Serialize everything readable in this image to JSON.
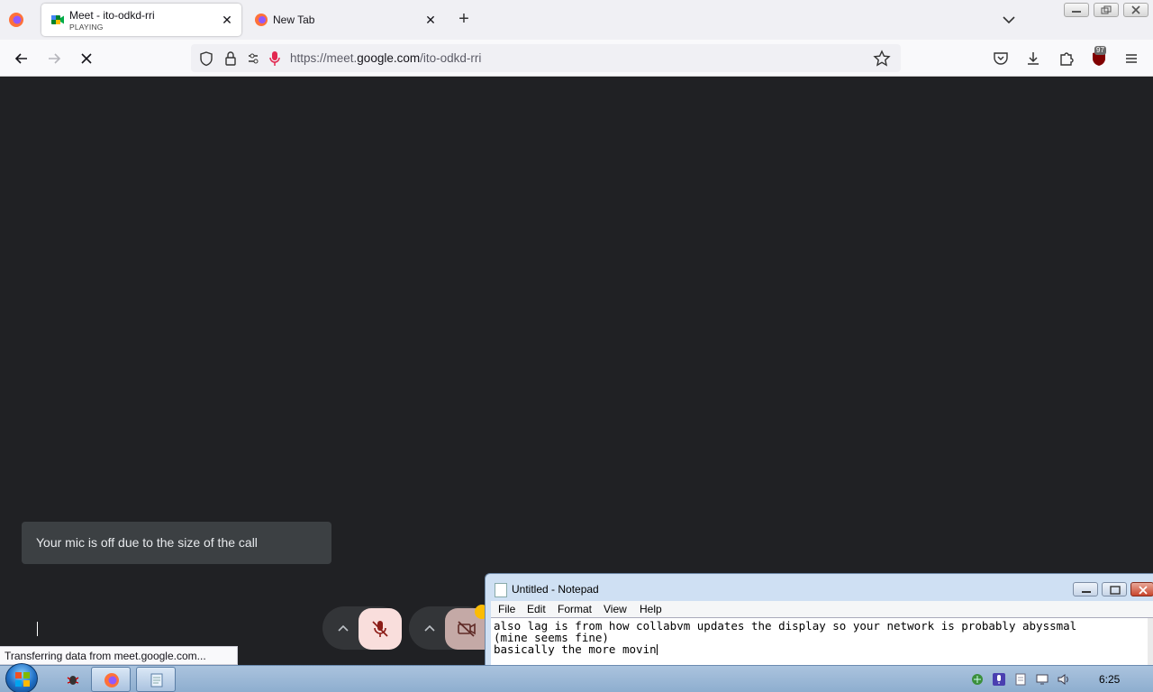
{
  "browser": {
    "tabs": [
      {
        "title": "Meet - ito-odkd-rri",
        "subtitle": "PLAYING",
        "active": true
      },
      {
        "title": "New Tab",
        "active": false
      }
    ],
    "url_prefix": "https://meet.",
    "url_host": "google.com",
    "url_path": "/ito-odkd-rri",
    "extension_badge": "97",
    "status_text": "Transferring data from meet.google.com..."
  },
  "meet": {
    "toast": "Your mic is off due to the size of the call",
    "mic_state": "off",
    "camera_state": "off"
  },
  "notepad": {
    "title": "Untitled - Notepad",
    "menu": [
      "File",
      "Edit",
      "Format",
      "View",
      "Help"
    ],
    "lines": [
      "also lag is from how collabvm updates the display so your network is probably abyssmal",
      "(mine seems fine)",
      "basically the more movin"
    ]
  },
  "taskbar": {
    "clock": "6:25"
  },
  "colors": {
    "meet_bg": "#202124",
    "toast_bg": "#3c4043",
    "mic_off_bg": "#f9dedc",
    "mic_off_icon": "#8c1d18"
  }
}
